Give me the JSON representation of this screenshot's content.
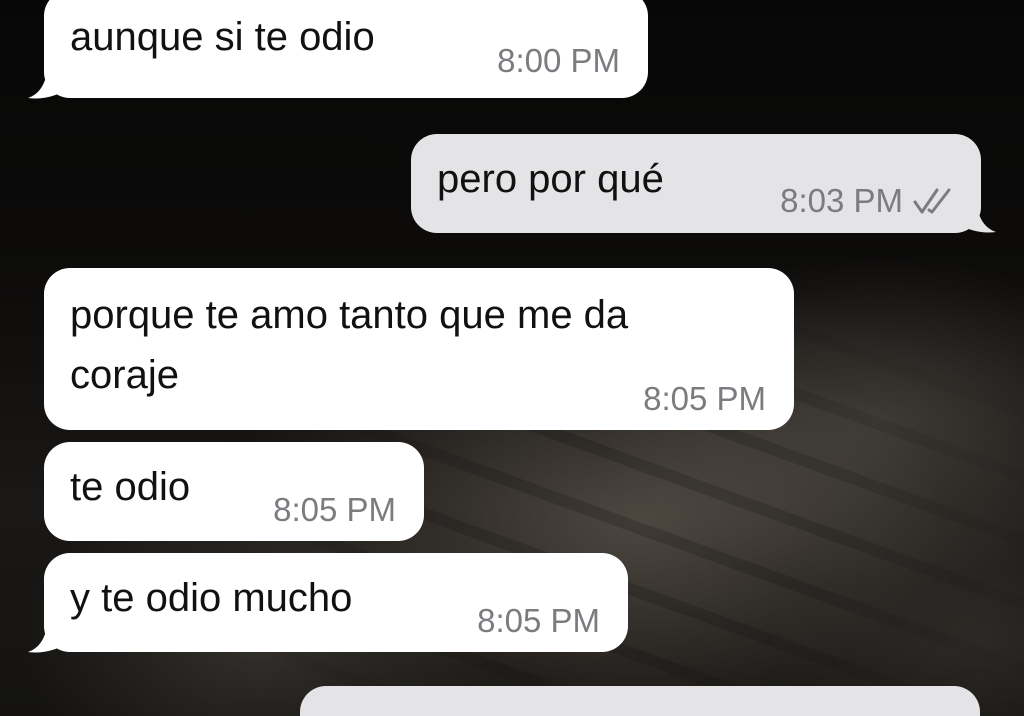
{
  "messages": [
    {
      "text": "aunque si te odio",
      "time": "8:00 PM",
      "direction": "incoming"
    },
    {
      "text": "pero por qué",
      "time": "8:03 PM",
      "direction": "outgoing",
      "status": "read",
      "status_icon": "double-check-icon"
    },
    {
      "text_lines": [
        "porque te amo tanto que me da",
        "coraje"
      ],
      "time": "8:05 PM",
      "direction": "incoming"
    },
    {
      "text": "te odio",
      "time": "8:05 PM",
      "direction": "incoming"
    },
    {
      "text": "y te odio mucho",
      "time": "8:05 PM",
      "direction": "incoming"
    },
    {
      "text": "",
      "time": "",
      "direction": "outgoing",
      "partially_visible": true
    }
  ],
  "colors": {
    "incoming_bubble": "#ffffff",
    "outgoing_bubble": "#e4e4e6",
    "timestamp": "#7c7c80",
    "wallpaper": "#0b0b0b"
  }
}
